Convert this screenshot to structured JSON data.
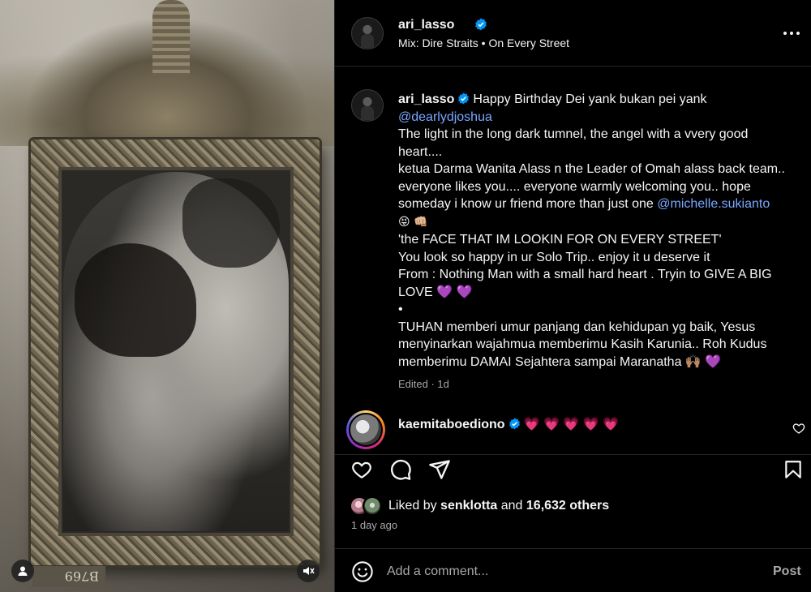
{
  "header": {
    "username": "ari_lasso",
    "audio_label": "Mix: Dire Straits • On Every Street"
  },
  "caption": {
    "username": "ari_lasso",
    "line1_text": "Happy Birthday Dei yank bukan pei yank",
    "mention1": "@dearlydjoshua",
    "line3": "The light in the long dark tumnel, the angel with a vvery good",
    "line4": "heart....",
    "line5": "ketua Darma Wanita Alass n the Leader of Omah alass back team..",
    "line6": "everyone likes you.... everyone warmly welcoming you.. hope",
    "line7_text": "someday i know ur friend more than just one ",
    "mention2": "@michelle.sukianto",
    "line8_emoji": "😝 👊🏼",
    "line9": "'the FACE THAT IM LOOKIN FOR ON EVERY STREET'",
    "line10": "You look so happy in ur Solo Trip.. enjoy it u deserve it",
    "line11": "From : Nothing Man with a small hard heart . Tryin to GIVE A BIG",
    "line12": "LOVE 💜 💜",
    "line13": "•",
    "line14": "TUHAN memberi umur panjang dan kehidupan yg baik, Yesus",
    "line15": "menyinarkan wajahmua memberimu Kasih Karunia.. Roh Kudus",
    "line16": "memberimu DAMAI Sejahtera sampai Maranatha 🙌🏽 💜",
    "meta": "Edited · 1d"
  },
  "comment": {
    "username": "kaemitaboediono",
    "text": "💗 💗 💗 💗 💗"
  },
  "likes": {
    "prefix": "Liked by ",
    "first_liker": "senklotta",
    "joiner": " and ",
    "others": "16,632 others"
  },
  "timestamp": "1 day ago",
  "comment_box": {
    "placeholder": "Add a comment...",
    "post_label": "Post"
  },
  "media": {
    "frame_label": "B769"
  },
  "colors": {
    "background": "#000000",
    "text": "#f5f5f5",
    "secondary_text": "#a8a8a8",
    "mention": "#7aa7ff",
    "verified": "#0095f6",
    "heart": "#ff3040"
  },
  "icons": [
    "verified-badge-icon",
    "more-icon",
    "heart-icon",
    "comment-icon",
    "share-icon",
    "bookmark-icon",
    "emoji-icon",
    "user-tag-icon",
    "mute-icon"
  ]
}
